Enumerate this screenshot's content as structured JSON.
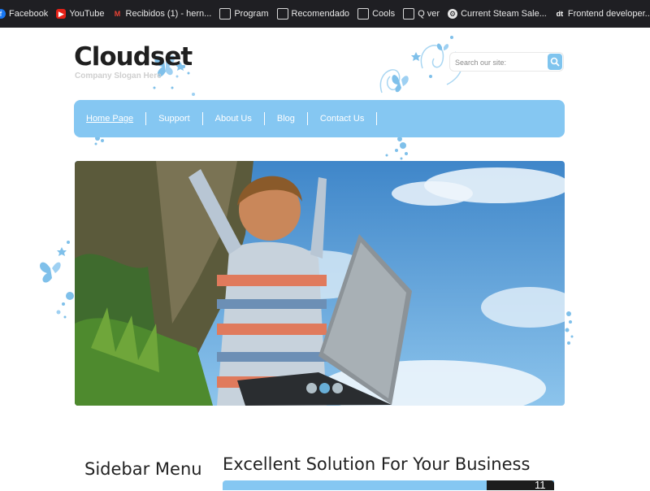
{
  "bookmarks": [
    {
      "icon": "facebook-icon",
      "label": "Facebook"
    },
    {
      "icon": "youtube-icon",
      "label": "YouTube"
    },
    {
      "icon": "gmail-icon",
      "label": "Recibidos (1) - hern..."
    },
    {
      "icon": "folder-icon",
      "label": "Program"
    },
    {
      "icon": "folder-icon",
      "label": "Recomendado"
    },
    {
      "icon": "folder-icon",
      "label": "Cools"
    },
    {
      "icon": "folder-icon",
      "label": "Q ver"
    },
    {
      "icon": "steam-icon",
      "label": "Current Steam Sale..."
    },
    {
      "icon": "dt-icon",
      "label": "Frontend developer..."
    }
  ],
  "header": {
    "logo": "Cloudset",
    "slogan": "Company Slogan Here",
    "search_placeholder": "Search our site:"
  },
  "nav": {
    "items": [
      "Home Page",
      "Support",
      "About Us",
      "Blog",
      "Contact Us"
    ],
    "active": "Home Page"
  },
  "slider": {
    "image": "boy-with-laptop-under-sky-photo",
    "dots": 3,
    "active_dot": 2
  },
  "sidebar": {
    "title": "Sidebar Menu"
  },
  "main": {
    "title": "Excellent Solution For Your Business",
    "badge": "11"
  },
  "colors": {
    "accent": "#85c7f2",
    "dark": "#1c1c1c",
    "bookmark_bar": "#1f1f23"
  }
}
